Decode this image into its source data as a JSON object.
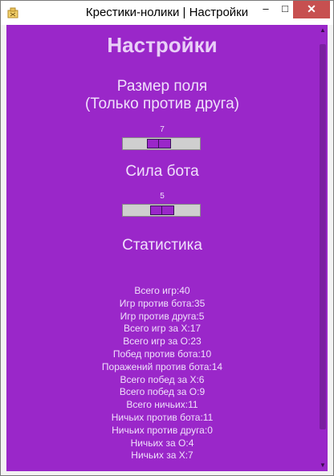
{
  "window": {
    "title": "Крестики-нолики | Настройки",
    "min_label": "–",
    "max_label": "□",
    "close_label": "✕"
  },
  "page": {
    "heading": "Настройки",
    "field_size": {
      "title_line1": "Размер поля",
      "title_line2": "(Только против друга)",
      "value": "7"
    },
    "bot_strength": {
      "title": "Сила бота",
      "value": "5"
    },
    "statistics": {
      "title": "Статистика",
      "items": [
        "Всего игр:40",
        "Игр против бота:35",
        "Игр против друга:5",
        "Всего игр за X:17",
        "Всего игр за O:23",
        "Побед против бота:10",
        "Поражений против бота:14",
        "Всего побед за X:6",
        "Всего побед за O:9",
        "Всего ничьих:11",
        "Ничьих против бота:11",
        "Ничьих против друга:0",
        "Ничьих за O:4",
        "Ничьих за X:7"
      ]
    }
  },
  "colors": {
    "background": "#9a27c9",
    "text": "#f0e0fb",
    "close_button": "#c75050"
  }
}
